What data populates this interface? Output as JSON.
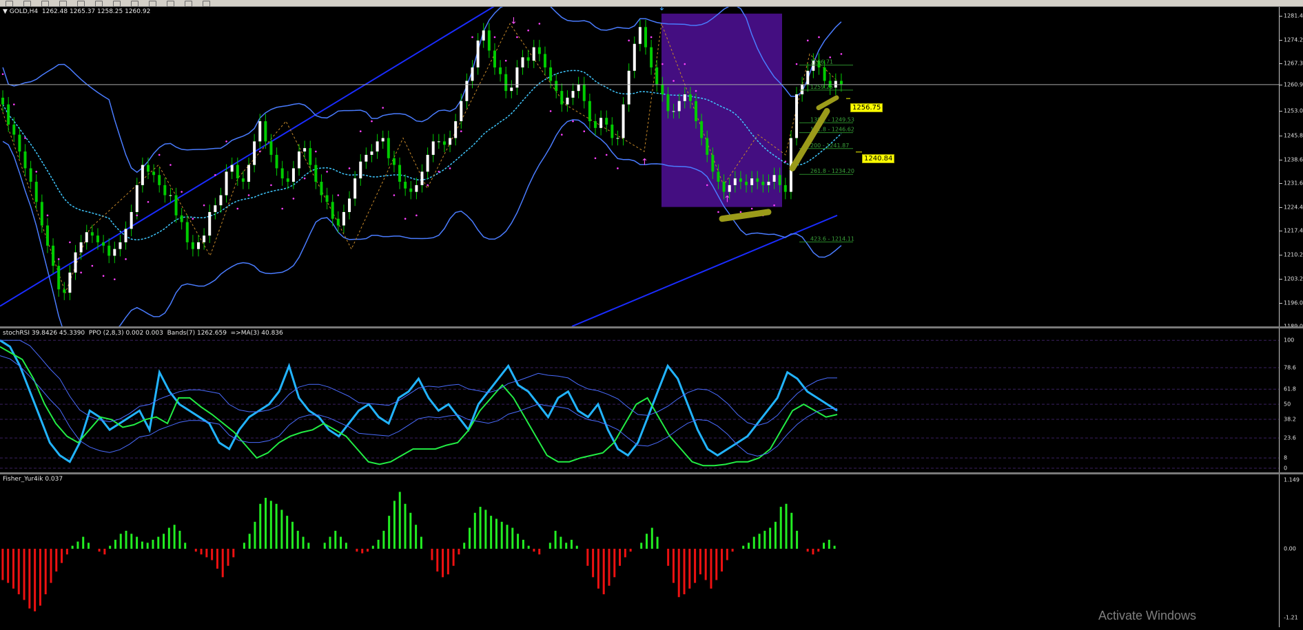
{
  "toolbar": {
    "icons": [
      "menu-icon",
      "file-icon",
      "new-order-icon",
      "open-icon",
      "cut-icon",
      "copy-icon",
      "paste-icon",
      "add-icon",
      "info-icon",
      "window-icon",
      "line-icon",
      "arrow-icon"
    ]
  },
  "main_pane": {
    "symbol_label": "▼ GOLD,H4  1262.48 1265.37 1258.25 1260.92",
    "current_price": "1260.9",
    "price_tag_1": "1256.75",
    "price_tag_2": "1240.84",
    "fib_labels": [
      "1266.71",
      "1259.25",
      "138.2 - 1249.53",
      "161.8 - 1246.62",
      "200 - 1241.87",
      "261.8 - 1234.20",
      "423.6 - 1214.11"
    ]
  },
  "stoch_pane": {
    "label": "stochRSI 39.8426 45.3390  PPO (2,8,3) 0.002 0.003  Bands(7) 1262.659  =>MA(3) 40.836"
  },
  "fisher_pane": {
    "label": "Fisher_Yur4ik 0.037"
  },
  "watermark": "Activate Windows",
  "colors": {
    "bull_candle": "#ffffff",
    "bear_candle": "#00cc00",
    "band": "#4a7cff",
    "channel": "#1a2cff",
    "sar": "#ff40ff",
    "stoch_main": "#22b4ff",
    "stoch_signal": "#22ee44",
    "fisher_pos": "#22ee22",
    "fisher_neg": "#ee1111",
    "highlight_box": "#4b0f8f",
    "arrow_marker": "#9b9b1a"
  },
  "chart_data": [
    {
      "type": "candlestick",
      "title": "GOLD,H4",
      "y_axis_ticks": [
        "1281.4",
        "1274.2",
        "1267.3",
        "1260.9",
        "1253.0",
        "1245.8",
        "1238.6",
        "1231.6",
        "1224.4",
        "1217.4",
        "1210.2",
        "1203.2",
        "1196.0",
        "1189.0"
      ],
      "ylim": [
        1189.0,
        1284.0
      ],
      "close_series": [
        1255,
        1249,
        1246,
        1241,
        1236,
        1232,
        1226,
        1219,
        1213,
        1207,
        1200,
        1199,
        1205,
        1211,
        1214,
        1217,
        1216,
        1214,
        1213,
        1210,
        1212,
        1214,
        1218,
        1223,
        1231,
        1237,
        1235,
        1234,
        1231,
        1228,
        1228,
        1222,
        1220,
        1214,
        1212,
        1214,
        1216,
        1223,
        1225,
        1228,
        1235,
        1237,
        1233,
        1232,
        1237,
        1244,
        1250,
        1244,
        1240,
        1236,
        1233,
        1232,
        1236,
        1241,
        1242,
        1237,
        1232,
        1228,
        1226,
        1221,
        1219,
        1223,
        1227,
        1233,
        1238,
        1240,
        1241,
        1244,
        1245,
        1239,
        1237,
        1232,
        1230,
        1229,
        1231,
        1235,
        1240,
        1244,
        1244,
        1243,
        1245,
        1250,
        1256,
        1262,
        1266,
        1274,
        1277,
        1271,
        1266,
        1264,
        1259,
        1260,
        1266,
        1269,
        1268,
        1272,
        1270,
        1266,
        1262,
        1259,
        1255,
        1257,
        1259,
        1261,
        1256,
        1250,
        1248,
        1251,
        1249,
        1245,
        1245,
        1255,
        1265,
        1273,
        1278,
        1272,
        1266,
        1261,
        1258,
        1253,
        1253,
        1256,
        1258,
        1256,
        1250,
        1245,
        1240,
        1235,
        1232,
        1229,
        1231,
        1233,
        1232,
        1231,
        1233,
        1232,
        1231,
        1232,
        1234,
        1231,
        1229,
        1245,
        1258,
        1261,
        1265,
        1268,
        1266,
        1262,
        1260,
        1262,
        1261
      ],
      "upper_band_ticks": [
        "1281.4"
      ],
      "sar_description": "parabolic SAR dots",
      "fib_levels": [
        {
          "label": "1266.71",
          "value": 1266.71
        },
        {
          "label": "1259.25",
          "value": 1259.25
        },
        {
          "label": "138.2 - 1249.53",
          "value": 1249.53
        },
        {
          "label": "161.8 - 1246.62",
          "value": 1246.62
        },
        {
          "label": "200 - 1241.87",
          "value": 1241.87
        },
        {
          "label": "261.8 - 1234.20",
          "value": 1234.2
        },
        {
          "label": "423.6 - 1214.11",
          "value": 1214.11
        }
      ],
      "price_tags": [
        1256.75,
        1240.84
      ],
      "current_price_line": 1260.9
    },
    {
      "type": "line",
      "title": "stochRSI 39.8426 45.3390  PPO (2,8,3) 0.002 0.003  Bands(7) 1262.659  =>MA(3) 40.836",
      "y_axis_ticks": [
        "100",
        "78.6",
        "61.8",
        "50",
        "38.2",
        "23.6",
        "8",
        "0"
      ],
      "ylim": [
        0,
        105
      ],
      "series": [
        {
          "name": "stochRSI",
          "values": [
            100,
            95,
            80,
            60,
            40,
            20,
            10,
            5,
            20,
            45,
            40,
            30,
            35,
            40,
            45,
            30,
            75,
            60,
            50,
            45,
            40,
            35,
            20,
            15,
            30,
            40,
            45,
            50,
            60,
            80,
            55,
            45,
            40,
            30,
            25,
            35,
            45,
            50,
            40,
            35,
            55,
            60,
            70,
            55,
            45,
            50,
            40,
            30,
            50,
            60,
            70,
            80,
            65,
            60,
            50,
            40,
            55,
            60,
            45,
            40,
            50,
            30,
            15,
            10,
            20,
            40,
            60,
            80,
            70,
            50,
            30,
            15,
            10,
            15,
            20,
            25,
            35,
            45,
            55,
            75,
            70,
            60,
            55,
            50,
            45
          ]
        },
        {
          "name": "PPO",
          "values": [
            95,
            90,
            85,
            70,
            50,
            35,
            25,
            20,
            30,
            40,
            38,
            32,
            34,
            38,
            40,
            35,
            55,
            55,
            48,
            42,
            35,
            28,
            18,
            8,
            12,
            20,
            25,
            28,
            30,
            35,
            30,
            25,
            15,
            5,
            3,
            5,
            10,
            15,
            15,
            15,
            18,
            20,
            30,
            45,
            55,
            65,
            55,
            40,
            25,
            10,
            5,
            5,
            8,
            10,
            12,
            20,
            35,
            50,
            55,
            40,
            25,
            15,
            5,
            2,
            2,
            3,
            5,
            5,
            8,
            15,
            30,
            45,
            50,
            45,
            40,
            42
          ]
        }
      ],
      "levels": [
        100,
        78.6,
        61.8,
        50,
        38.2,
        23.6,
        8,
        0
      ]
    },
    {
      "type": "bar",
      "title": "Fisher_Yur4ik 0.037",
      "y_axis_ticks": [
        "1.149",
        "0.00",
        "-1.21"
      ],
      "ylim": [
        -1.21,
        1.149
      ],
      "values": [
        -0.55,
        -0.6,
        -0.7,
        -0.8,
        -0.9,
        -1.05,
        -1.1,
        -1.0,
        -0.8,
        -0.6,
        -0.4,
        -0.25,
        -0.1,
        0.05,
        0.12,
        0.2,
        0.1,
        0.0,
        -0.05,
        -0.1,
        0.05,
        0.15,
        0.25,
        0.3,
        0.25,
        0.2,
        0.12,
        0.1,
        0.15,
        0.2,
        0.25,
        0.35,
        0.4,
        0.3,
        0.1,
        0.0,
        -0.05,
        -0.1,
        -0.15,
        -0.2,
        -0.35,
        -0.5,
        -0.3,
        -0.15,
        0.0,
        0.1,
        0.25,
        0.45,
        0.75,
        0.85,
        0.8,
        0.75,
        0.65,
        0.55,
        0.45,
        0.3,
        0.2,
        0.1,
        0.0,
        0.0,
        0.1,
        0.2,
        0.3,
        0.2,
        0.1,
        0.0,
        -0.05,
        -0.08,
        -0.05,
        0.05,
        0.15,
        0.3,
        0.55,
        0.8,
        0.95,
        0.75,
        0.6,
        0.4,
        0.2,
        0.0,
        -0.2,
        -0.4,
        -0.5,
        -0.45,
        -0.3,
        -0.1,
        0.1,
        0.35,
        0.6,
        0.7,
        0.65,
        0.55,
        0.5,
        0.45,
        0.4,
        0.35,
        0.25,
        0.15,
        0.05,
        -0.05,
        -0.1,
        0.0,
        0.1,
        0.3,
        0.2,
        0.1,
        0.15,
        0.05,
        0.0,
        -0.3,
        -0.5,
        -0.7,
        -0.8,
        -0.65,
        -0.5,
        -0.3,
        -0.15,
        -0.05,
        0.0,
        0.1,
        0.25,
        0.35,
        0.2,
        0.0,
        -0.3,
        -0.6,
        -0.85,
        -0.8,
        -0.7,
        -0.6,
        -0.45,
        -0.55,
        -0.7,
        -0.55,
        -0.4,
        -0.2,
        -0.05,
        0.0,
        0.05,
        0.1,
        0.2,
        0.25,
        0.3,
        0.35,
        0.45,
        0.7,
        0.75,
        0.6,
        0.3,
        0.0,
        -0.05,
        -0.1,
        -0.05,
        0.1,
        0.15,
        0.05
      ]
    }
  ]
}
